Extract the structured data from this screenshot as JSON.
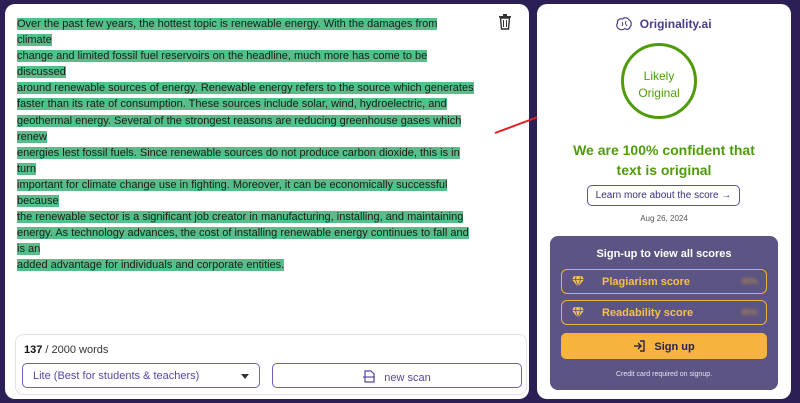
{
  "editor": {
    "text_lines": [
      "Over the past few years, the hottest topic is renewable energy. With the damages from climate",
      "change and limited fossil fuel reservoirs on the headline, much more has come to be discussed",
      "around renewable sources of energy. Renewable energy refers to the source which generates",
      "faster than its rate of consumption. These sources include solar, wind, hydroelectric, and",
      "geothermal energy. Several of the strongest reasons are reducing greenhouse gases which renew",
      "energies lest fossil fuels. Since renewable sources do not produce carbon dioxide, this is in turn",
      "important for climate change use in fighting. Moreover, it can be economically successful because",
      "the renewable sector is a significant job creator in manufacturing, installing, and maintaining",
      "energy. As technology advances, the cost of installing renewable energy continues to fall and is an",
      "added advantage for individuals and corporate entities."
    ],
    "highlight_color": "#53c08a",
    "trash_icon": "trash-icon",
    "word_count": "137",
    "word_limit": "/ 2000 words",
    "mode_select": "Lite (Best for students & teachers)",
    "scan_label": "new scan"
  },
  "result": {
    "brand": "Originality.ai",
    "verdict_line1": "Likely",
    "verdict_line2": "Original",
    "confidence_line1": "We are 100% confident that",
    "confidence_line2": "text is original",
    "learn_more": "Learn more about the score →",
    "date": "Aug 26, 2024",
    "accent_color": "#4f9c0a"
  },
  "signup": {
    "title": "Sign-up to view all scores",
    "plagiarism_label": "Plagiarism score",
    "plagiarism_value": "80%",
    "readability_label": "Readability score",
    "readability_value": "80%",
    "button": "Sign up",
    "note": "Credit card required on signup."
  }
}
